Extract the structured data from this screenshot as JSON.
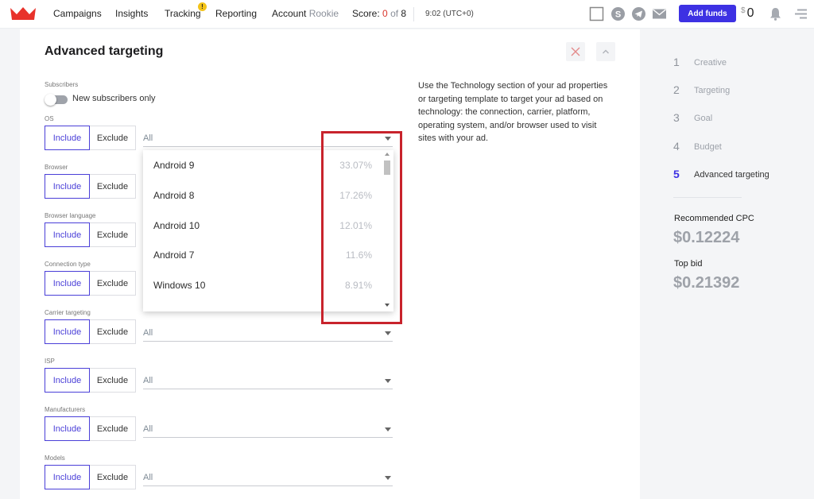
{
  "topbar": {
    "nav": [
      "Campaigns",
      "Insights",
      "Tracking",
      "Reporting"
    ],
    "tracking_badge": "!",
    "account_label": "Account",
    "account_level": "Rookie",
    "score_label": "Score:",
    "score_value": "0",
    "score_of": "of",
    "score_total": "8",
    "time": "9:02 (UTC+0)",
    "add_funds": "Add funds",
    "currency": "$",
    "balance": "0"
  },
  "main": {
    "title": "Advanced targeting",
    "subscribers_label": "Subscribers",
    "toggle_label": "New subscribers only",
    "include": "Include",
    "exclude": "Exclude",
    "all": "All",
    "fields": [
      "OS",
      "Browser",
      "Browser language",
      "Connection type",
      "Carrier targeting",
      "ISP",
      "Manufacturers",
      "Models"
    ],
    "os_options": [
      {
        "name": "Android 9",
        "pct": "33.07%"
      },
      {
        "name": "Android 8",
        "pct": "17.26%"
      },
      {
        "name": "Android 10",
        "pct": "12.01%"
      },
      {
        "name": "Android 7",
        "pct": "11.6%"
      },
      {
        "name": "Windows 10",
        "pct": "8.91%"
      }
    ],
    "help": "Use the Technology section of your ad properties or targeting template to target your ad based on technology: the connection, carrier, platform, operating system, and/or browser used to visit sites with your ad."
  },
  "sidebar": {
    "steps": [
      {
        "num": "1",
        "label": "Creative"
      },
      {
        "num": "2",
        "label": "Targeting"
      },
      {
        "num": "3",
        "label": "Goal"
      },
      {
        "num": "4",
        "label": "Budget"
      },
      {
        "num": "5",
        "label": "Advanced targeting"
      }
    ],
    "active_step": 5,
    "recommended_cpc_label": "Recommended CPC",
    "recommended_cpc": "$0.12224",
    "top_bid_label": "Top bid",
    "top_bid": "$0.21392"
  },
  "colors": {
    "accent": "#3d31e3",
    "brand_logo": "#e8322b",
    "highlight": "#c8232c",
    "badge": "#f3c318"
  },
  "icons": [
    "crown-logo-icon",
    "fullscreen-icon",
    "skype-icon",
    "telegram-icon",
    "mail-icon",
    "bell-icon",
    "menu-icon",
    "close-icon",
    "chevron-up-icon",
    "dropdown-caret-icon"
  ]
}
